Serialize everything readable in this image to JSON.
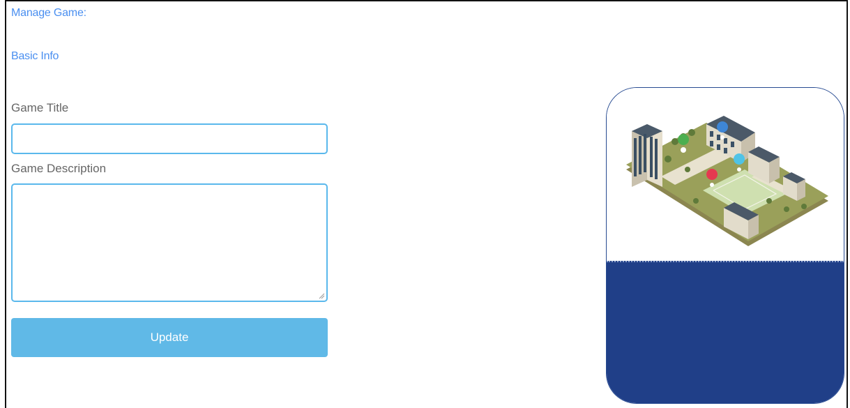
{
  "header": {
    "manage_label": "Manage Game:",
    "section_label": "Basic Info"
  },
  "form": {
    "title_label": "Game Title",
    "title_value": "",
    "description_label": "Game Description",
    "description_value": "",
    "update_label": "Update"
  },
  "preview": {
    "image": "isometric-campus-illustration",
    "colors": {
      "card_bottom": "#203f88",
      "accent": "#60b9e7",
      "link": "#4a8ff0"
    },
    "markers": [
      "green-check-pin",
      "blue-pin",
      "cyan-pin",
      "red-pin"
    ]
  }
}
